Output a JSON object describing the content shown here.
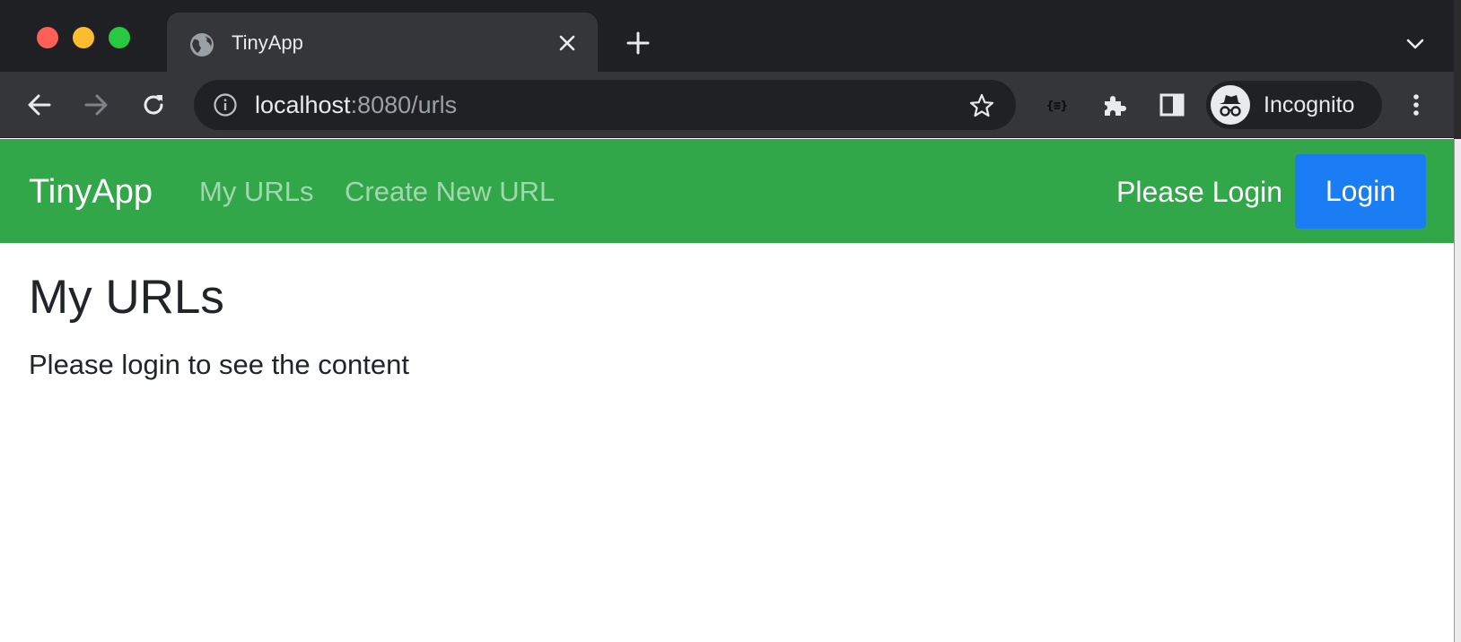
{
  "browser": {
    "tab_title": "TinyApp",
    "url_host": "localhost",
    "url_rest": ":8080/urls",
    "profile_label": "Incognito"
  },
  "navbar": {
    "brand": "TinyApp",
    "links": [
      "My URLs",
      "Create New URL"
    ],
    "status": "Please Login",
    "login_label": "Login"
  },
  "main": {
    "title": "My URLs",
    "message": "Please login to see the content"
  },
  "colors": {
    "navbar": "#31a74a",
    "login_button": "#1a7df3",
    "chrome_dark": "#1f2023",
    "chrome_toolbar": "#35363a"
  },
  "icons": [
    "globe-icon",
    "close-icon",
    "plus-icon",
    "chevron-down-icon",
    "back-arrow-icon",
    "forward-arrow-icon",
    "reload-icon",
    "info-icon",
    "star-icon",
    "json-viewer-icon",
    "puzzle-icon",
    "side-panel-icon",
    "incognito-icon",
    "more-vert-icon"
  ]
}
